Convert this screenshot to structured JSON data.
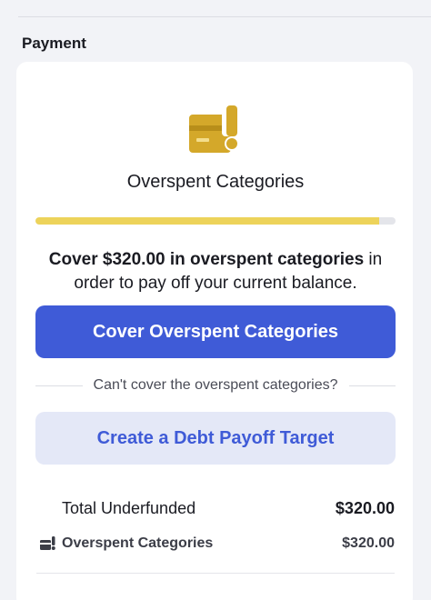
{
  "section": {
    "title": "Payment"
  },
  "status": {
    "title": "Overspent Categories",
    "progress_fraction": 0.955,
    "colors": {
      "accent_yellow": "#edd35a",
      "icon_gold": "#d4a82a"
    },
    "icon": "overspent-card-alert-icon"
  },
  "message": {
    "bold_part": "Cover $320.00 in overspent categories",
    "rest": " in order to pay off your current balance."
  },
  "actions": {
    "primary_label": "Cover Overspent Categories",
    "or_text": "Can't cover the overspent categories?",
    "secondary_label": "Create a Debt Payoff Target",
    "colors": {
      "primary_bg": "#3f5bd7",
      "secondary_bg": "#e4e8f7"
    }
  },
  "summary": {
    "label": "Total Underfunded",
    "amount": "$320.00"
  },
  "detail": {
    "icon": "overspent-card-icon",
    "label": "Overspent Categories",
    "amount": "$320.00"
  }
}
